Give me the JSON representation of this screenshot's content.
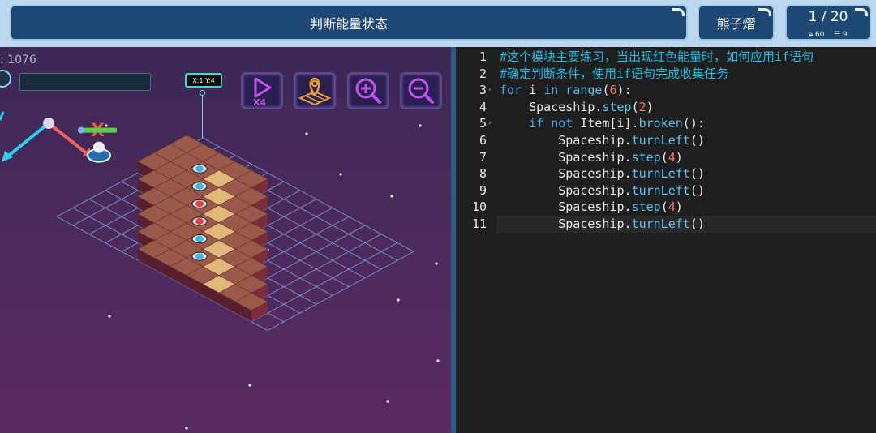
{
  "header": {
    "title": "判断能量状态",
    "username": "熊子熠",
    "level": "1 / 20",
    "stat1": "60",
    "stat2": "9",
    "stat1_icon": "lock-icon",
    "stat2_icon": "list-icon"
  },
  "game": {
    "score_label": ": 1076",
    "coord": "X:1 Y:4",
    "axis_x_label": "X",
    "tools": [
      {
        "name": "speed-x4-button",
        "label": "X4"
      },
      {
        "name": "map-locate-button",
        "label": ""
      },
      {
        "name": "zoom-in-button",
        "label": ""
      },
      {
        "name": "zoom-out-button",
        "label": ""
      }
    ]
  },
  "editor": {
    "line_numbers": [
      "1",
      "2",
      "3",
      "4",
      "5",
      "6",
      "7",
      "8",
      "9",
      "10",
      "11"
    ],
    "lines": [
      "#这个模块主要练习，当出现红色能量时，如何应用if语句",
      "#确定判断条件，使用if语句完成收集任务",
      "for i in range(6):",
      "    Spaceship.step(2)",
      "    if not Item[i].broken():",
      "        Spaceship.turnLeft()",
      "        Spaceship.step(4)",
      "        Spaceship.turnLeft()",
      "        Spaceship.turnLeft()",
      "        Spaceship.step(4)",
      "        Spaceship.turnLeft()"
    ]
  },
  "colors": {
    "accent": "#1d4873",
    "comment": "#1fc0e8",
    "keyword": "#3fb0f0",
    "number": "#ff6b5b",
    "energy_red": "#e8403a",
    "energy_blue": "#3fb6e8"
  }
}
